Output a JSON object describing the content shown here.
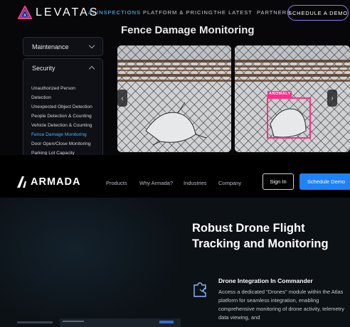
{
  "levatas": {
    "logo_text": "LEVATAS",
    "nav": [
      "AI INSPECTIONS",
      "PLATFORM & PRICING",
      "THE LATEST",
      "PARTNERS"
    ],
    "cta": "SCHEDULE A DEMO",
    "title": "Fence Damage Monitoring",
    "maintenance_label": "Maintenance",
    "security_label": "Security",
    "security_items": [
      "Unauthorized Person Detection",
      "Unexpected Object Detection",
      "People Detection & Counting",
      "Vehicle Detection & Counting",
      "Fence Damage Monitoring",
      "Door Open/Close Monitoring",
      "Parking Lot Capacity"
    ],
    "active_item": "Fence Damage Monitoring",
    "anomaly_label": "ANOMALY",
    "accent_color": "#4db3ff",
    "anomaly_color": "#ff2d8a"
  },
  "armada": {
    "logo_text": "ARMADA",
    "nav": [
      "Products",
      "Why Armada?",
      "Industries",
      "Company"
    ],
    "sign_in": "Sign In",
    "schedule_demo": "Schedule Demo",
    "headline": "Robust Drone Flight Tracking and Monitoring",
    "feature_icon": "puzzle-icon",
    "feature_title": "Drone Integration In Commander",
    "feature_text": "Access a dedicated \"Drones\" module within the Atlas platform for seamless integration, enabling comprehensive monitoring of drone activity, telemetry data viewing, and",
    "accent_color": "#1f82f6"
  }
}
